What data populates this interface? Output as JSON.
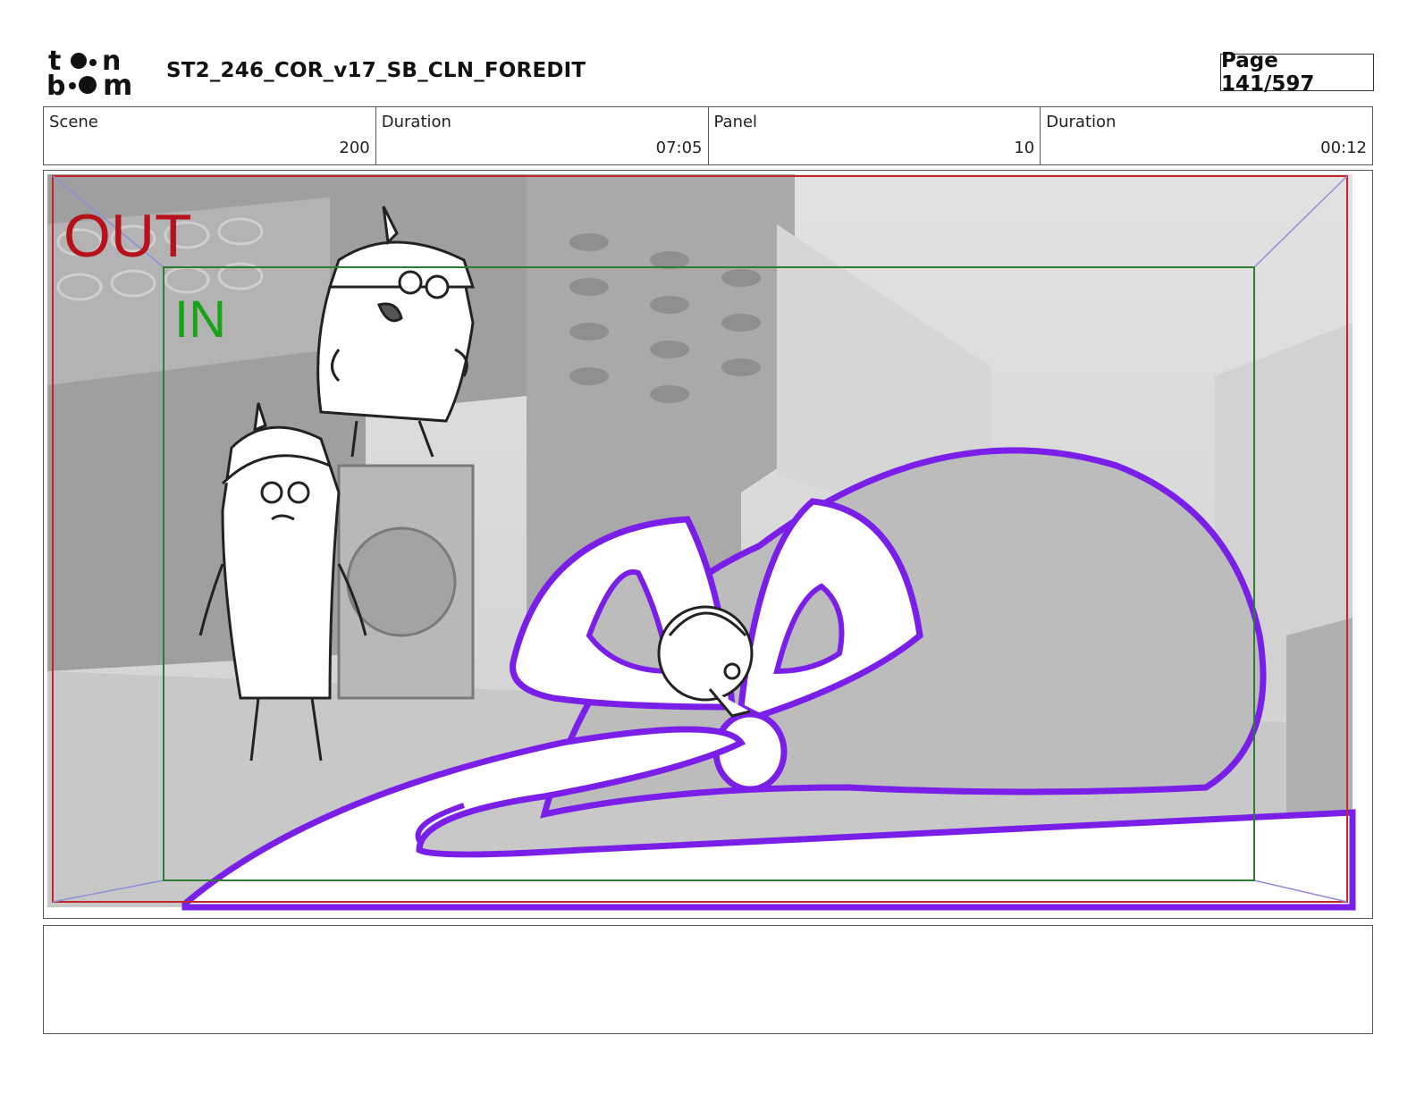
{
  "header": {
    "logo_alt": "toon boom",
    "title": "ST2_246_COR_v17_SB_CLN_FOREDIT",
    "page": "Page 141/597"
  },
  "info": {
    "scene_label": "Scene",
    "scene_value": "200",
    "scene_duration_label": "Duration",
    "scene_duration_value": "07:05",
    "panel_label": "Panel",
    "panel_value": "10",
    "panel_duration_label": "Duration",
    "panel_duration_value": "00:12"
  },
  "panel": {
    "out_label": "OUT",
    "in_label": "IN"
  },
  "colors": {
    "out_frame": "#c0262c",
    "in_frame": "#2f7d32",
    "ribbon": "#7a1fe8",
    "sketch_gray": "#b9b9b9"
  }
}
